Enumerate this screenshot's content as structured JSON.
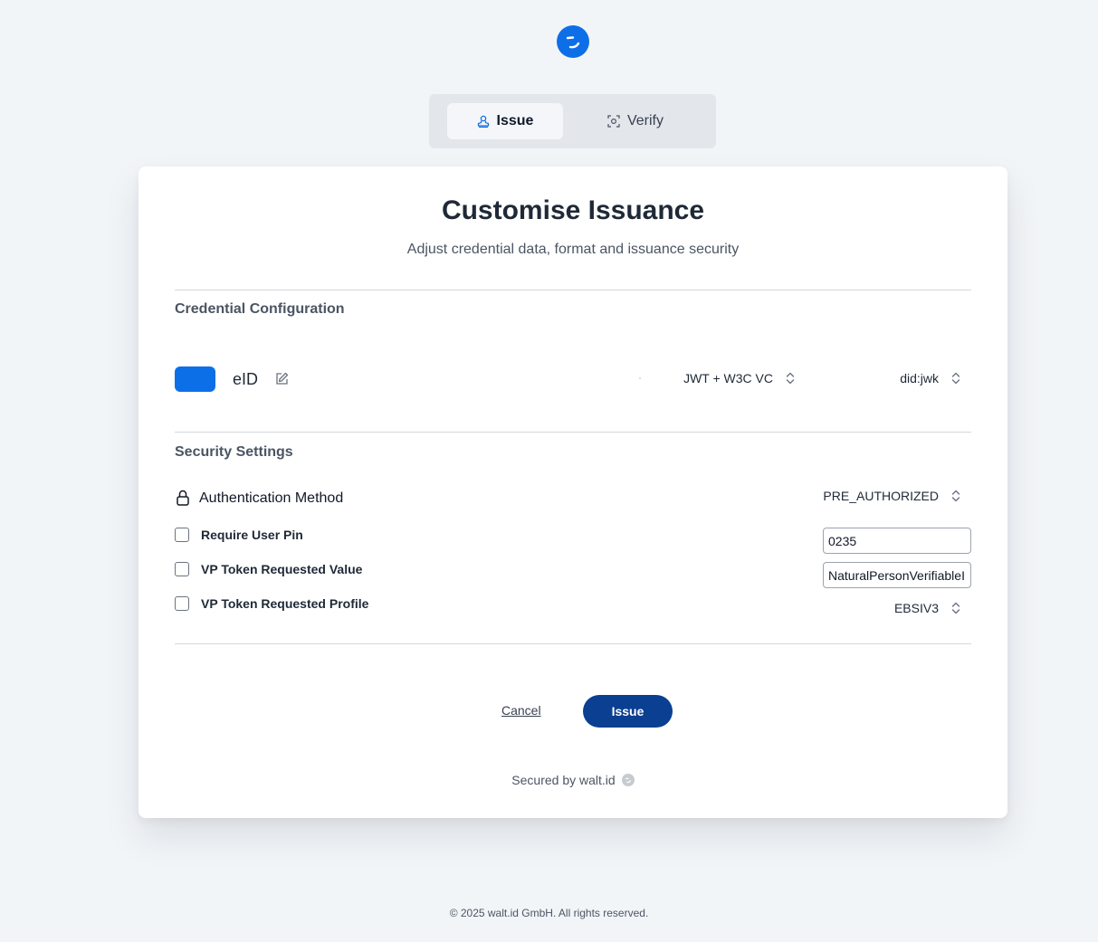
{
  "brand": {
    "accent": "#0d6fe8",
    "primary_button": "#0a3f91",
    "logo_icon": "walt-id-logo-icon"
  },
  "tabs": {
    "issue": {
      "label": "Issue",
      "icon": "stamp-icon",
      "active": true
    },
    "verify": {
      "label": "Verify",
      "icon": "scan-icon",
      "active": false
    }
  },
  "card": {
    "title": "Customise Issuance",
    "subtitle": "Adjust credential data, format and issuance security"
  },
  "credential_config": {
    "heading": "Credential Configuration",
    "credential_name": "eID",
    "format": "JWT + W3C VC",
    "did_method": "did:jwk"
  },
  "security": {
    "heading": "Security Settings",
    "auth_method_label": "Authentication Method",
    "auth_method_value": "PRE_AUTHORIZED",
    "options": [
      {
        "label": "Require User Pin",
        "checked": false,
        "input_value": "0235"
      },
      {
        "label": "VP Token Requested Value",
        "checked": false,
        "input_value": "NaturalPersonVerifiableID"
      },
      {
        "label": "VP Token Requested Profile",
        "checked": false,
        "select_value": "EBSIV3"
      }
    ]
  },
  "actions": {
    "cancel": "Cancel",
    "issue": "Issue"
  },
  "secured_by": "Secured by walt.id",
  "footer": "© 2025 walt.id GmbH. All rights reserved."
}
